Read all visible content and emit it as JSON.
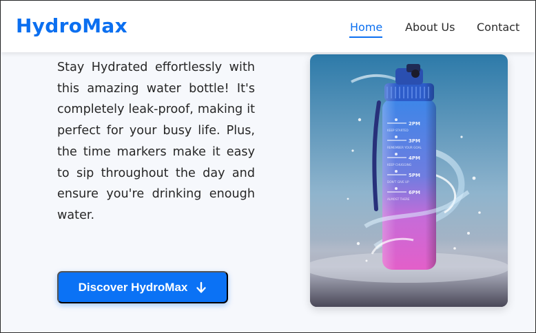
{
  "brand": {
    "name": "HydroMax",
    "color": "#0b6ff0"
  },
  "nav": {
    "items": [
      {
        "label": "Home",
        "active": true
      },
      {
        "label": "About Us",
        "active": false
      },
      {
        "label": "Contact",
        "active": false
      }
    ]
  },
  "hero": {
    "description": "Stay Hydrated effortlessly with this amazing water bottle! It's completely leak-proof, making it perfect for your busy life. Plus, the time markers make it easy to sip throughout the day and ensure you're drinking enough water.",
    "cta_label": "Discover HydroMax",
    "cta_icon": "arrow-down-icon"
  },
  "product_image": {
    "bottle_markers": [
      {
        "time": "2PM",
        "note": "KEEP STARTED"
      },
      {
        "time": "3PM",
        "note": "REMEMBER YOUR GOAL"
      },
      {
        "time": "4PM",
        "note": "KEEP CHUGGING"
      },
      {
        "time": "5PM",
        "note": "DON'T GIVE UP"
      },
      {
        "time": "6PM",
        "note": "ALMOST THERE"
      }
    ]
  },
  "colors": {
    "accent": "#0b6ff0",
    "button": "#0b72f5",
    "page_background": "#f6f8fc"
  }
}
